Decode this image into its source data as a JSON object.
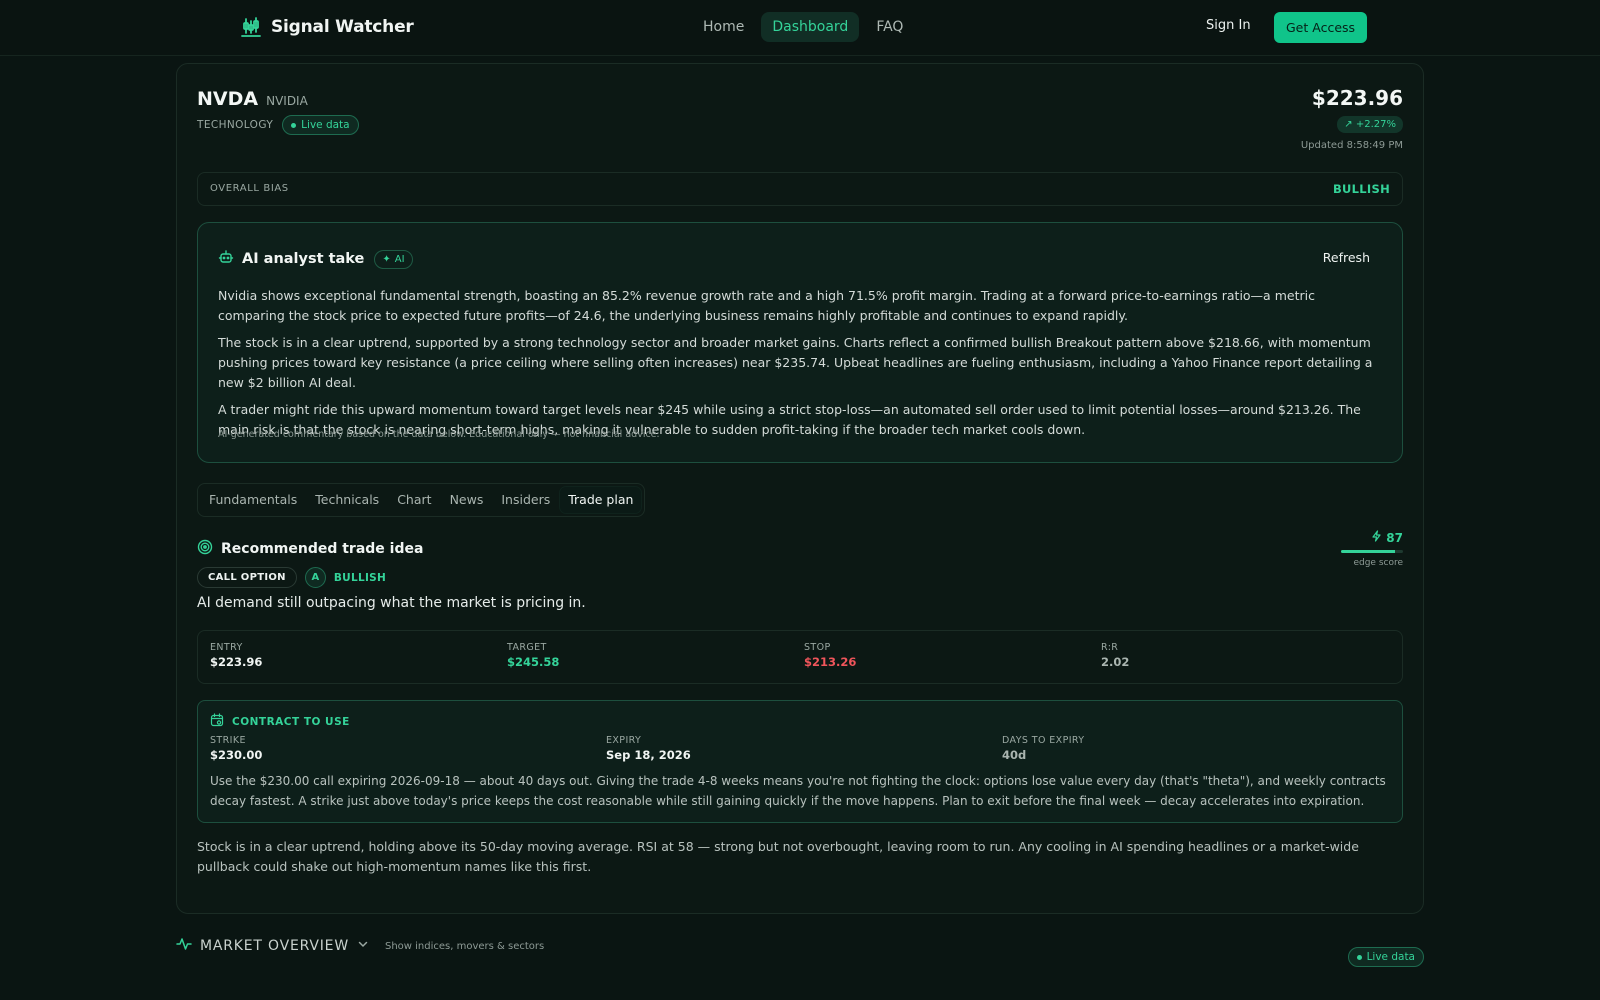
{
  "brand": {
    "name": "Signal Watcher"
  },
  "nav": {
    "links": [
      "Home",
      "Dashboard",
      "FAQ"
    ],
    "active": "Dashboard",
    "sign_in": "Sign In",
    "get_access": "Get Access"
  },
  "stock": {
    "ticker": "NVDA",
    "company": "NVIDIA",
    "sector": "TECHNOLOGY",
    "live_label": "Live data",
    "price": "$223.96",
    "change": "+2.27%",
    "updated": "Updated 8:58:49 PM",
    "bias_label": "OVERALL BIAS",
    "bias_value": "BULLISH"
  },
  "ai": {
    "title": "AI analyst take",
    "badge": "AI",
    "refresh": "Refresh",
    "paragraphs": [
      "Nvidia shows exceptional fundamental strength, boasting an 85.2% revenue growth rate and a high 71.5% profit margin. Trading at a forward price-to-earnings ratio—a metric comparing the stock price to expected future profits—of 24.6, the underlying business remains highly profitable and continues to expand rapidly.",
      "The stock is in a clear uptrend, supported by a strong technology sector and broader market gains. Charts reflect a confirmed bullish Breakout pattern above $218.66, with momentum pushing prices toward key resistance (a price ceiling where selling often increases) near $235.74. Upbeat headlines are fueling enthusiasm, including a Yahoo Finance report detailing a new $2 billion AI deal.",
      "A trader might ride this upward momentum toward target levels near $245 while using a strict stop-loss—an automated sell order used to limit potential losses—around $213.26. The main risk is that the stock is nearing short-term highs, making it vulnerable to sudden profit-taking if the broader tech market cools down."
    ],
    "footnote": "AI-generated commentary based on the data below. Educational only — not financial advice."
  },
  "tabs": [
    "Fundamentals",
    "Technicals",
    "Chart",
    "News",
    "Insiders",
    "Trade plan"
  ],
  "active_tab": "Trade plan",
  "trade": {
    "title": "Recommended trade idea",
    "type": "CALL OPTION",
    "grade": "A",
    "direction": "BULLISH",
    "edge_score": "87",
    "edge_fraction": 0.87,
    "edge_label": "edge score",
    "thesis": "AI demand still outpacing what the market is pricing in.",
    "levels": [
      {
        "label": "ENTRY",
        "value": "$223.96"
      },
      {
        "label": "TARGET",
        "value": "$245.58"
      },
      {
        "label": "STOP",
        "value": "$213.26"
      },
      {
        "label": "R:R",
        "value": "2.02"
      }
    ],
    "contract": {
      "title": "CONTRACT TO USE",
      "fields": [
        {
          "label": "STRIKE",
          "value": "$230.00"
        },
        {
          "label": "EXPIRY",
          "value": "Sep 18, 2026"
        },
        {
          "label": "DAYS TO EXPIRY",
          "value": "40d"
        }
      ],
      "description": "Use the $230.00 call expiring 2026-09-18 — about 40 days out. Giving the trade 4-8 weeks means you're not fighting the clock: options lose value every day (that's \"theta\"), and weekly contracts decay fastest. A strike just above today's price keeps the cost reasonable while still gaining quickly if the move happens. Plan to exit before the final week — decay accelerates into expiration."
    },
    "summary": "Stock is in a clear uptrend, holding above its 50-day moving average. RSI at 58 — strong but not overbought, leaving room to run. Any cooling in AI spending headlines or a market-wide pullback could shake out high-momentum names like this first."
  },
  "market": {
    "title": "MARKET OVERVIEW",
    "subtitle": "Show indices, movers & sectors",
    "live_label": "Live data"
  },
  "colors": {
    "accent": "#34d399",
    "negative": "#f0555b",
    "background": "#0a1512"
  }
}
